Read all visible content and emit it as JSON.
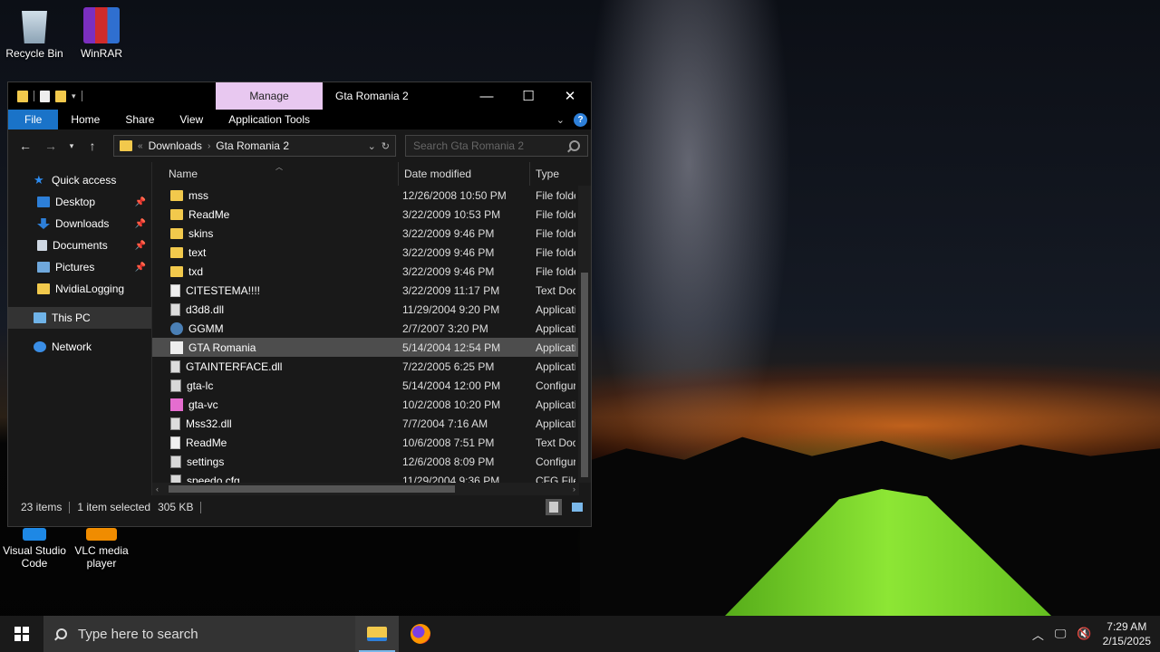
{
  "desktop": {
    "icons": [
      {
        "label": "Recycle Bin"
      },
      {
        "label": "WinRAR"
      },
      {
        "label": "Visual Studio Code"
      },
      {
        "label": "VLC media player"
      }
    ]
  },
  "window": {
    "title": "Gta Romania 2",
    "manage_tab": "Manage",
    "ribbon_tabs": [
      "File",
      "Home",
      "Share",
      "View",
      "Application Tools"
    ],
    "address": {
      "prefix": "«",
      "crumbs": [
        "Downloads",
        "Gta Romania 2"
      ]
    },
    "search_placeholder": "Search Gta Romania 2",
    "sidebar": {
      "quick_access": "Quick access",
      "items": [
        "Desktop",
        "Downloads",
        "Documents",
        "Pictures",
        "NvidiaLogging"
      ],
      "this_pc": "This PC",
      "network": "Network"
    },
    "columns": [
      "Name",
      "Date modified",
      "Type"
    ],
    "files": [
      {
        "name": "mss",
        "date": "12/26/2008 10:50 PM",
        "type": "File folder",
        "icon": "folder-icon"
      },
      {
        "name": "ReadMe",
        "date": "3/22/2009 10:53 PM",
        "type": "File folder",
        "icon": "folder-icon"
      },
      {
        "name": "skins",
        "date": "3/22/2009 9:46 PM",
        "type": "File folder",
        "icon": "folder-icon"
      },
      {
        "name": "text",
        "date": "3/22/2009 9:46 PM",
        "type": "File folder",
        "icon": "folder-icon"
      },
      {
        "name": "txd",
        "date": "3/22/2009 9:46 PM",
        "type": "File folder",
        "icon": "folder-icon"
      },
      {
        "name": "CITESTEMA!!!!",
        "date": "3/22/2009 11:17 PM",
        "type": "Text Document",
        "icon": "text-file-icon"
      },
      {
        "name": "d3d8.dll",
        "date": "11/29/2004 9:20 PM",
        "type": "Application extension",
        "icon": "dll-file-icon"
      },
      {
        "name": "GGMM",
        "date": "2/7/2007 3:20 PM",
        "type": "Application",
        "icon": "app-icon"
      },
      {
        "name": "GTA Romania",
        "date": "5/14/2004 12:54 PM",
        "type": "Application",
        "icon": "lc-app-icon"
      },
      {
        "name": "GTAINTERFACE.dll",
        "date": "7/22/2005 6:25 PM",
        "type": "Application extension",
        "icon": "dll-file-icon"
      },
      {
        "name": "gta-lc",
        "date": "5/14/2004 12:00 PM",
        "type": "Configuration settings",
        "icon": "config-file-icon"
      },
      {
        "name": "gta-vc",
        "date": "10/2/2008 10:20 PM",
        "type": "Application",
        "icon": "vc-app-icon"
      },
      {
        "name": "Mss32.dll",
        "date": "7/7/2004 7:16 AM",
        "type": "Application extension",
        "icon": "dll-file-icon"
      },
      {
        "name": "ReadMe",
        "date": "10/6/2008 7:51 PM",
        "type": "Text Document",
        "icon": "text-file-icon"
      },
      {
        "name": "settings",
        "date": "12/6/2008 8:09 PM",
        "type": "Configuration settings",
        "icon": "config-file-icon"
      },
      {
        "name": "speedo.cfg",
        "date": "11/29/2004 9:36 PM",
        "type": "CFG File",
        "icon": "config-file-icon"
      }
    ],
    "selected_index": 8,
    "status": {
      "count": "23 items",
      "selection": "1 item selected",
      "size": "305 KB"
    }
  },
  "taskbar": {
    "search_placeholder": "Type here to search",
    "time": "7:29 AM",
    "date": "2/15/2025"
  },
  "colors": {
    "accent": "#1a73c8",
    "manage_tab": "#e8c8f0",
    "folder": "#f2c94c"
  }
}
